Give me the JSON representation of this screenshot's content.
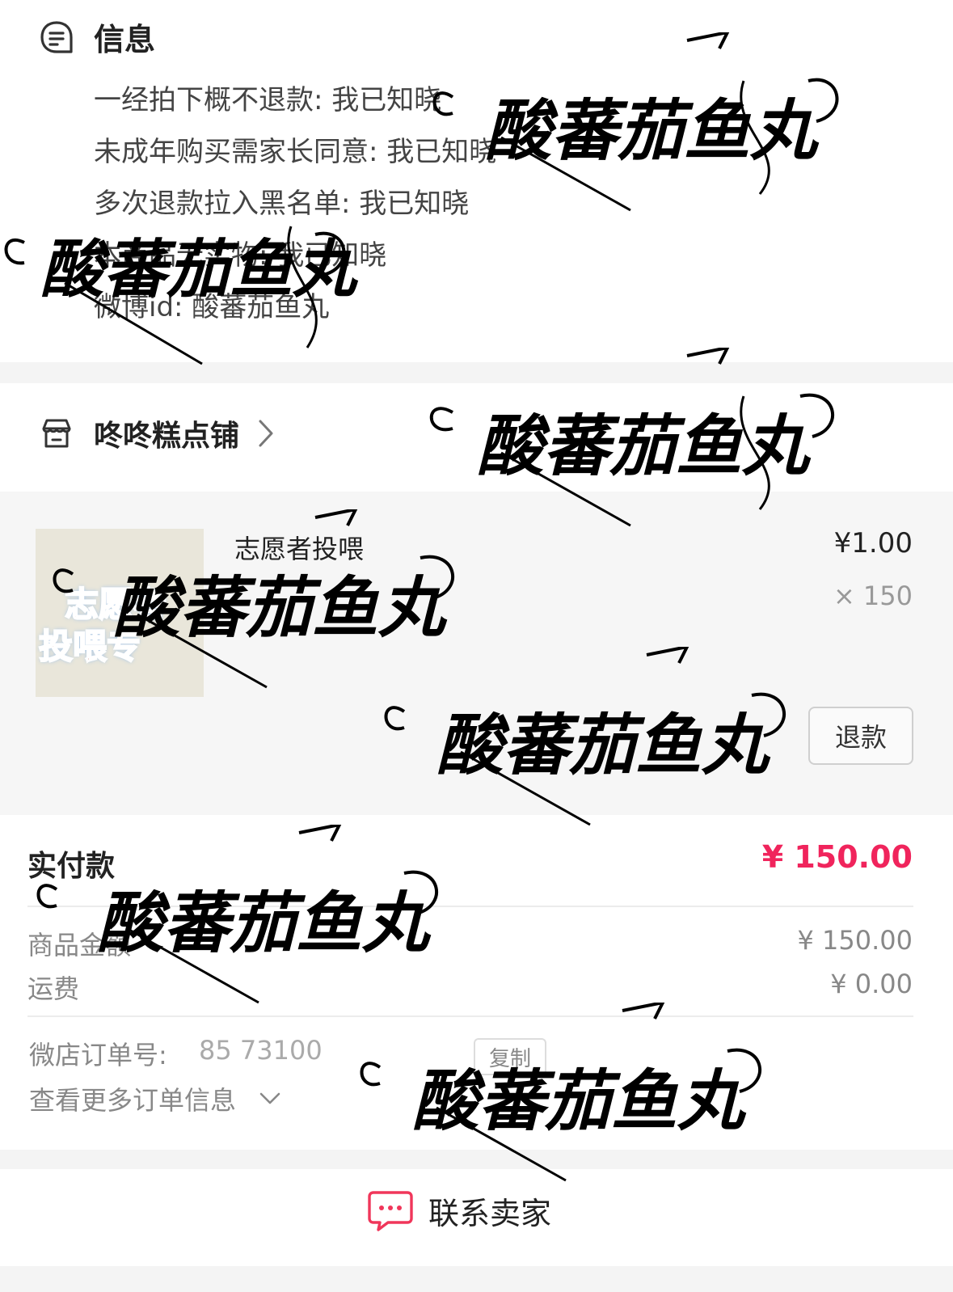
{
  "info": {
    "title": "信息",
    "lines": [
      "一经拍下概不退款: 我已知晓",
      "未成年购买需家长同意: 我已知晓",
      "多次退款拉入黑名单: 我已知晓",
      "本商品无实物: 我已知晓",
      "微博id: 酸蕃茄鱼丸"
    ]
  },
  "shop": {
    "name": "咚咚糕点铺"
  },
  "item": {
    "thumb_line1": "志愿者",
    "thumb_line2": "投喂专",
    "title": "志愿者投喂",
    "price": "¥1.00",
    "quantity": "× 150",
    "refund_label": "退款"
  },
  "payment": {
    "paid_label": "实付款",
    "paid_amount": "¥ 150.00",
    "goods_label": "商品金额",
    "goods_value": "¥ 150.00",
    "shipping_label": "运费",
    "shipping_value": "¥ 0.00",
    "order_label": "微店订单号:",
    "order_number": "85           73100",
    "copy_label": "复制",
    "more_label": "查看更多订单信息"
  },
  "footer": {
    "contact_label": "联系卖家"
  },
  "watermark": {
    "text": "酸蕃茄鱼丸"
  },
  "colors": {
    "accent_price": "#f0245c",
    "contact_icon": "#f0365a"
  }
}
